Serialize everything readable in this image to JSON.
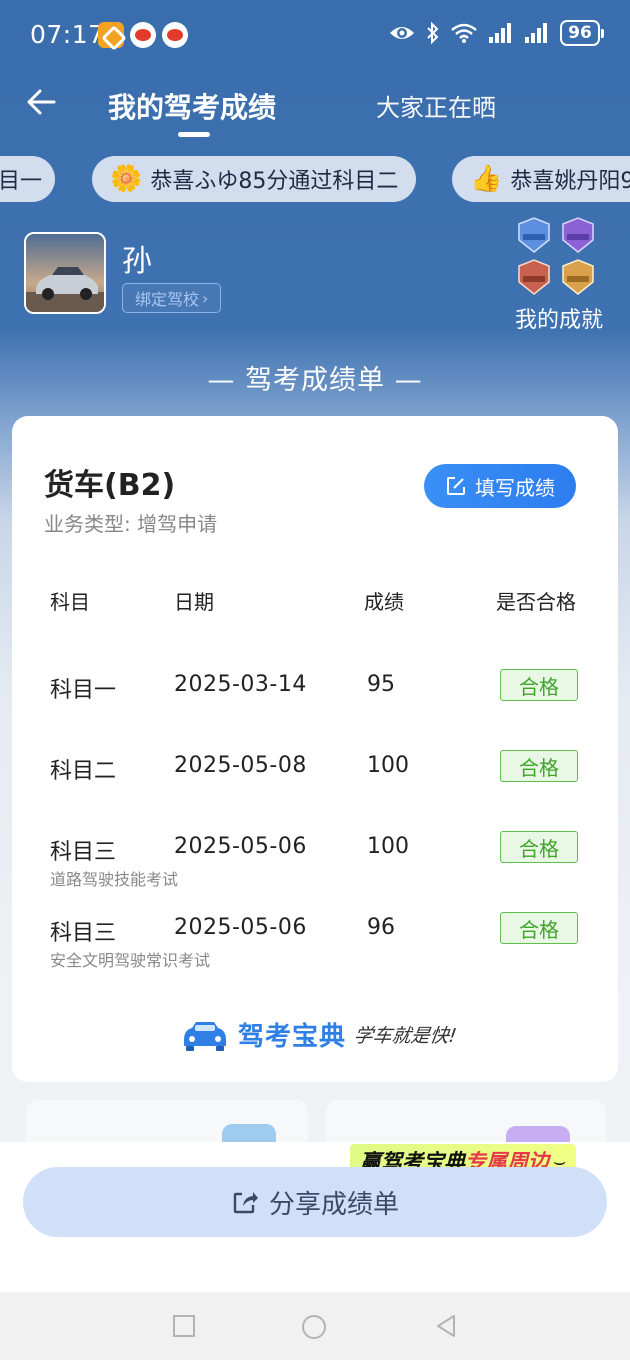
{
  "status": {
    "time": "07:17",
    "battery": "96",
    "app_icons": [
      "orange-app-icon",
      "weibo-icon",
      "weibo-icon"
    ],
    "system_icons": [
      "eye-icon",
      "bluetooth-icon",
      "wifi-icon",
      "signal-icon",
      "signal-icon"
    ]
  },
  "header": {
    "tab_active": "我的驾考成绩",
    "tab_other": "大家正在晒"
  },
  "ticker": [
    {
      "emoji": "",
      "text": "目一"
    },
    {
      "emoji": "🌼",
      "text": "恭喜ふゆ85分通过科目二"
    },
    {
      "emoji": "👍",
      "text": "恭喜姚丹阳9"
    }
  ],
  "profile": {
    "name": "孙",
    "bind_label": "绑定驾校",
    "achievements_label": "我的成就"
  },
  "section_title": "— 驾考成绩单 —",
  "card": {
    "vehicle": "货车(B2)",
    "business": "业务类型:  增驾申请",
    "fill_label": "填写成绩",
    "headers": [
      "科目",
      "日期",
      "成绩",
      "是否合格"
    ],
    "rows": [
      {
        "subject": "科目一",
        "sub": "",
        "date": "2025-03-14",
        "score": "95",
        "result": "合格"
      },
      {
        "subject": "科目二",
        "sub": "",
        "date": "2025-05-08",
        "score": "100",
        "result": "合格"
      },
      {
        "subject": "科目三",
        "sub": "道路驾驶技能考试",
        "date": "2025-05-06",
        "score": "100",
        "result": "合格"
      },
      {
        "subject": "科目三",
        "sub": "安全文明驾驶常识考试",
        "date": "2025-05-06",
        "score": "96",
        "result": "合格"
      }
    ],
    "brand_name": "驾考宝典",
    "brand_slogan": "学车就是快!"
  },
  "promo": {
    "part_a": "赢驾考宝典",
    "part_b": "专属周边"
  },
  "share_label": "分享成绩单",
  "colors": {
    "header_blue": "#3f72b0",
    "accent_blue": "#2d7df0",
    "pass_green": "#3fa52a",
    "share_bg": "#cfe0f8"
  }
}
